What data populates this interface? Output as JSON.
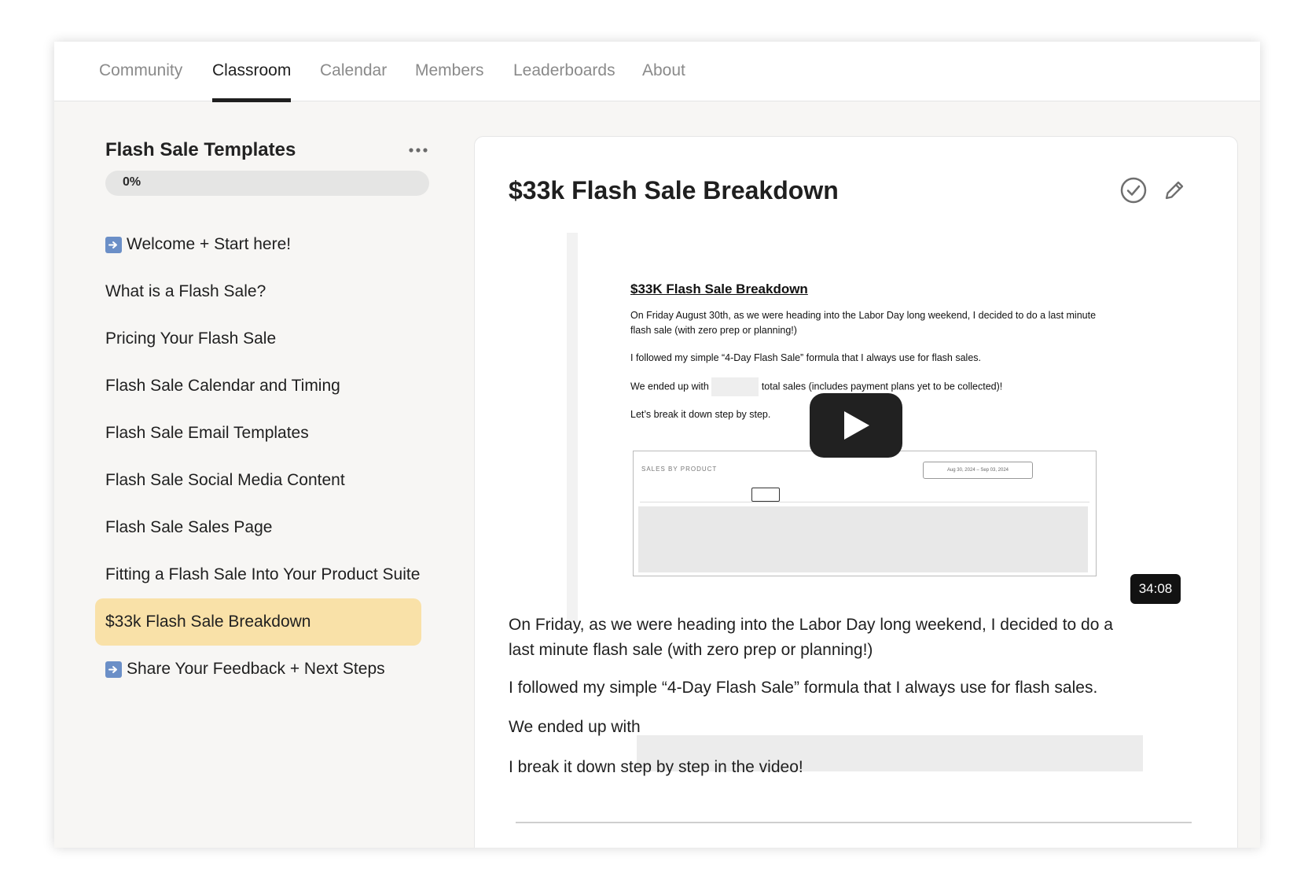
{
  "nav": {
    "tabs": [
      {
        "label": "Community",
        "active": false
      },
      {
        "label": "Classroom",
        "active": true
      },
      {
        "label": "Calendar",
        "active": false
      },
      {
        "label": "Members",
        "active": false
      },
      {
        "label": "Leaderboards",
        "active": false
      },
      {
        "label": "About",
        "active": false
      }
    ]
  },
  "sidebar": {
    "course_title": "Flash Sale Templates",
    "progress_label": "0%",
    "progress_value": 0,
    "lessons": [
      {
        "label": "Welcome + Start here!",
        "icon": "arrow-right-icon"
      },
      {
        "label": "What is a Flash Sale?"
      },
      {
        "label": "Pricing Your Flash Sale"
      },
      {
        "label": "Flash Sale Calendar and Timing"
      },
      {
        "label": "Flash Sale Email Templates"
      },
      {
        "label": "Flash Sale Social Media Content"
      },
      {
        "label": "Flash Sale Sales Page"
      },
      {
        "label": "Fitting a Flash Sale Into Your Product Suite"
      },
      {
        "label": "$33k Flash Sale Breakdown",
        "active": true
      },
      {
        "label": "Share Your Feedback + Next Steps",
        "icon": "arrow-right-icon"
      }
    ]
  },
  "lesson": {
    "title": "$33k Flash Sale Breakdown",
    "video": {
      "duration": "34:08",
      "doc_heading": "$33K Flash Sale Breakdown",
      "doc_line1": "On Friday August 30th, as we were heading into the Labor Day long weekend, I decided to do a last minute flash sale (with zero prep or planning!)",
      "doc_line2": "I followed my simple “4-Day Flash Sale” formula that I always use for flash sales.",
      "doc_line3a": "We ended up with",
      "doc_line3b": "total sales (includes payment plans yet to be collected)!",
      "doc_line4": "Let’s break it down step by step.",
      "table_header": "SALES BY PRODUCT",
      "table_range": "Aug 30, 2024 – Sep 03, 2024"
    },
    "paragraphs": {
      "p1": "On Friday, as we were heading into the Labor Day long weekend, I decided to do a last minute flash sale (with zero prep or planning!)",
      "p2": "I followed my simple “4-Day Flash Sale” formula that I always use for flash sales.",
      "p3": "We ended up with",
      "p4": "I break it down step by step in the video!"
    }
  },
  "colors": {
    "active_lesson_bg": "#f9e1a8",
    "accent_dark": "#1f1f1f"
  }
}
